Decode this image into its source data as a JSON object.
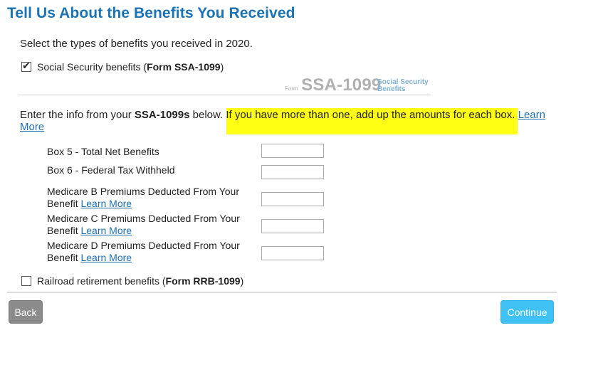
{
  "page": {
    "title": "Tell Us About the Benefits You Received",
    "instruction": "Select the types of benefits you received in 2020."
  },
  "ssa_option": {
    "checked": true,
    "label_prefix": "Social Security benefits (",
    "label_bold": "Form SSA-1099",
    "label_suffix": ")"
  },
  "form_logo": {
    "form_word": "Form",
    "form_number": "SSA-1099",
    "description_line1": "Social Security",
    "description_line2": "Benefits"
  },
  "info_text": {
    "part1": "Enter the info from your ",
    "bold": "SSA-1099s",
    "part2": " below. ",
    "highlighted": "If you have more than one, add up the amounts for each box.",
    "link_line1": "Learn",
    "link_line2": "More"
  },
  "fields": [
    {
      "label": "Box 5 - Total Net Benefits",
      "value": ""
    },
    {
      "label": "Box 6 - Federal Tax Withheld",
      "value": ""
    },
    {
      "label_line1": "Medicare B Premiums Deducted From Your",
      "label_line2": "Benefit ",
      "link": "Learn More",
      "value": ""
    },
    {
      "label_line1": "Medicare C Premiums Deducted From Your",
      "label_line2": "Benefit ",
      "link": "Learn More",
      "value": ""
    },
    {
      "label_line1": "Medicare D Premiums Deducted From Your",
      "label_line2": "Benefit ",
      "link": "Learn More",
      "value": ""
    }
  ],
  "rrb_option": {
    "checked": false,
    "label_prefix": "Railroad retirement benefits (",
    "label_bold": "Form RRB-1099",
    "label_suffix": ")"
  },
  "buttons": {
    "back": "Back",
    "continue": "Continue"
  },
  "colors": {
    "title": "#1a73b5",
    "link": "#1f6fb0",
    "highlight": "#ffff14",
    "back_button": "#8b8b8b",
    "continue_button": "#3fc1f3"
  }
}
